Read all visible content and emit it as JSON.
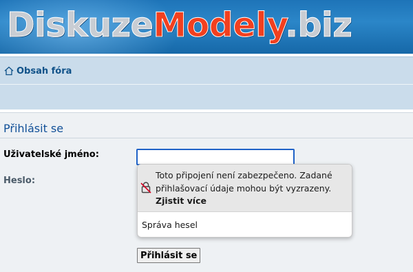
{
  "banner": {
    "title_part1": "Diskuze",
    "title_part2": "Modely",
    "title_part3": ".biz"
  },
  "nav": {
    "home_icon": "home-icon",
    "forum_index_label": "Obsah fóra"
  },
  "login": {
    "title": "Přihlásit se",
    "username_label": "Uživatelské jméno:",
    "username_value": "",
    "password_label": "Heslo:",
    "submit_label": "Přihlásit se"
  },
  "password_popup": {
    "lock_icon": "broken-lock-icon",
    "warning_text": "Toto připojení není zabezpečeno. Zadané přihlašovací údaje mohou být vyzrazeny.",
    "learn_more": "Zjistit více",
    "manage_passwords": "Správa hesel"
  },
  "colors": {
    "banner_blue": "#1e74b8",
    "title_red": "#f2401f",
    "link_blue": "#105289",
    "navbar_bg": "#cadceb",
    "panel_bg": "#eef1f4",
    "input_focus": "#1f62c7"
  }
}
